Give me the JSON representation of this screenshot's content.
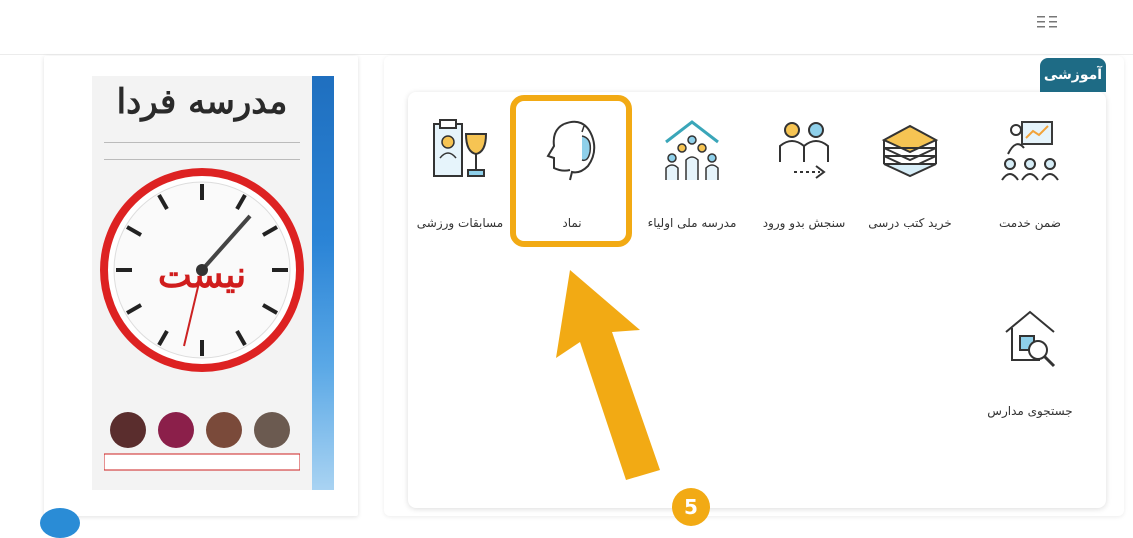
{
  "header": {
    "menu_icon": "grid-menu-icon"
  },
  "category": {
    "tab_label": "آموزشی",
    "tab_color": "#1e6b85"
  },
  "services": [
    {
      "label": "ضمن خدمت",
      "icon": "teacher-presentation-icon"
    },
    {
      "label": "خرید کتب درسی",
      "icon": "stacked-books-icon"
    },
    {
      "label": "سنجش بدو ورود",
      "icon": "entrance-assessment-icon"
    },
    {
      "label": "مدرسه ملی اولیاء",
      "icon": "parents-school-icon"
    },
    {
      "label": "نماد",
      "icon": "head-apple-icon"
    },
    {
      "label": "مسابقات ورزشی",
      "icon": "sports-trophy-icon"
    },
    {
      "label": "جستجوی مدارس",
      "icon": "school-search-icon"
    }
  ],
  "annotation": {
    "step_number": "5",
    "highlight_color": "#f2aa14"
  },
  "magazine": {
    "title": "مدرسه فردا",
    "headline": "نیست",
    "icon": "magazine-cover-image"
  }
}
